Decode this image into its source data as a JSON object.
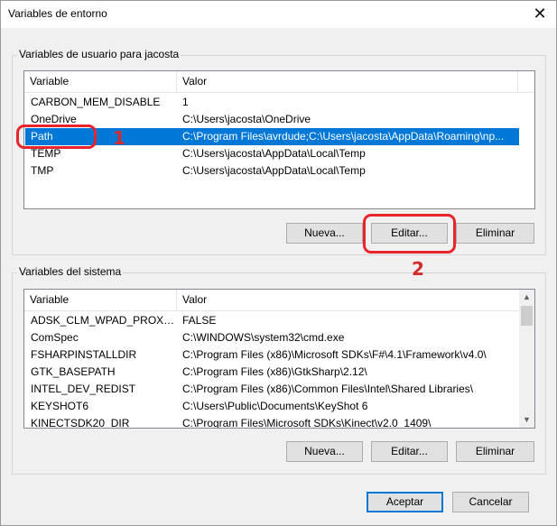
{
  "window": {
    "title": "Variables de entorno",
    "close_glyph": "✕"
  },
  "user_group": {
    "label": "Variables de usuario para jacosta",
    "columns": [
      "Variable",
      "Valor"
    ],
    "rows": [
      {
        "variable": "CARBON_MEM_DISABLE",
        "valor": "1"
      },
      {
        "variable": "OneDrive",
        "valor": "C:\\Users\\jacosta\\OneDrive"
      },
      {
        "variable": "Path",
        "valor": "C:\\Program Files\\avrdude;C:\\Users\\jacosta\\AppData\\Roaming\\np..."
      },
      {
        "variable": "TEMP",
        "valor": "C:\\Users\\jacosta\\AppData\\Local\\Temp"
      },
      {
        "variable": "TMP",
        "valor": "C:\\Users\\jacosta\\AppData\\Local\\Temp"
      }
    ],
    "selected_row": 2,
    "buttons": {
      "new": "Nueva...",
      "edit": "Editar...",
      "delete": "Eliminar"
    }
  },
  "system_group": {
    "label": "Variables del sistema",
    "columns": [
      "Variable",
      "Valor"
    ],
    "rows": [
      {
        "variable": "ADSK_CLM_WPAD_PROXY_...",
        "valor": "FALSE"
      },
      {
        "variable": "ComSpec",
        "valor": "C:\\WINDOWS\\system32\\cmd.exe"
      },
      {
        "variable": "FSHARPINSTALLDIR",
        "valor": "C:\\Program Files (x86)\\Microsoft SDKs\\F#\\4.1\\Framework\\v4.0\\"
      },
      {
        "variable": "GTK_BASEPATH",
        "valor": "C:\\Program Files (x86)\\GtkSharp\\2.12\\"
      },
      {
        "variable": "INTEL_DEV_REDIST",
        "valor": "C:\\Program Files (x86)\\Common Files\\Intel\\Shared Libraries\\"
      },
      {
        "variable": "KEYSHOT6",
        "valor": "C:\\Users\\Public\\Documents\\KeyShot 6"
      },
      {
        "variable": "KINECTSDK20_DIR",
        "valor": "C:\\Program Files\\Microsoft SDKs\\Kinect\\v2.0_1409\\"
      }
    ],
    "buttons": {
      "new": "Nueva...",
      "edit": "Editar...",
      "delete": "Eliminar"
    }
  },
  "footer": {
    "accept": "Aceptar",
    "cancel": "Cancelar"
  },
  "annotations": {
    "marker_1": "1",
    "marker_2": "2"
  },
  "colors": {
    "selection": "#0078d7",
    "annotation": "#e8242c",
    "default_button_border": "#0078d7"
  }
}
